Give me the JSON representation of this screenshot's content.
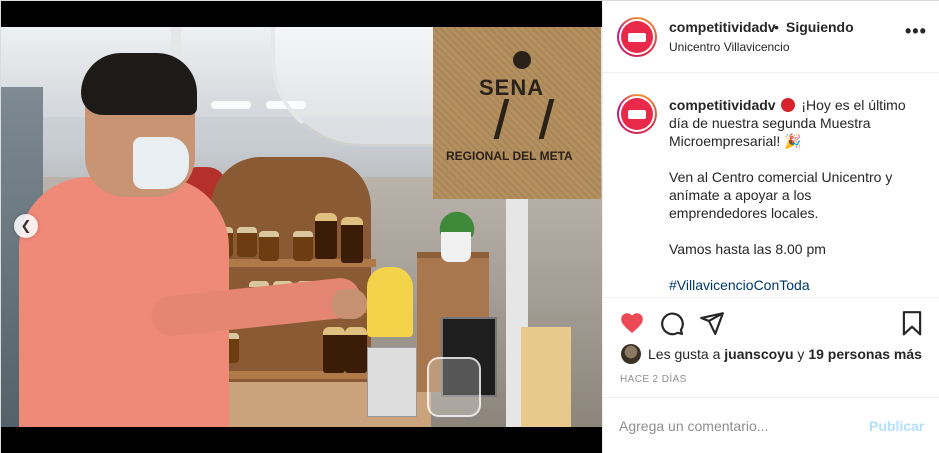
{
  "post": {
    "username": "competitividadv",
    "separator": "•",
    "follow_status": "Siguiendo",
    "location": "Unicentro Villavicencio",
    "more_label": "•••"
  },
  "photo": {
    "bag_brand": "SENA",
    "bag_region": "REGIONAL DEL META"
  },
  "caption": {
    "username": "competitividadv",
    "line1": "¡Hoy es el último",
    "line2": "día de nuestra segunda Muestra",
    "line3": "Microempresarial! 🎉",
    "line4": "Ven al Centro comercial Unicentro y",
    "line5": "anímate a apoyar a los",
    "line6": "emprendedores locales.",
    "line7": "Vamos hasta las 8.00 pm",
    "hashtag": "#VillavicencioConToda"
  },
  "likes": {
    "prefix": "Les gusta a",
    "user": "juanscoyu",
    "middle": "y",
    "others": "19 personas más"
  },
  "time_ago": "HACE 2 DÍAS",
  "comment": {
    "placeholder": "Agrega un comentario...",
    "post_label": "Publicar"
  },
  "colors": {
    "like_red": "#ed4956",
    "link_blue": "#00376b",
    "publish_disabled": "#b2dffc"
  },
  "icons": {
    "like": "heart-icon",
    "comment": "comment-icon",
    "share": "paper-plane-icon",
    "save": "bookmark-icon",
    "prev": "chevron-left-icon"
  }
}
